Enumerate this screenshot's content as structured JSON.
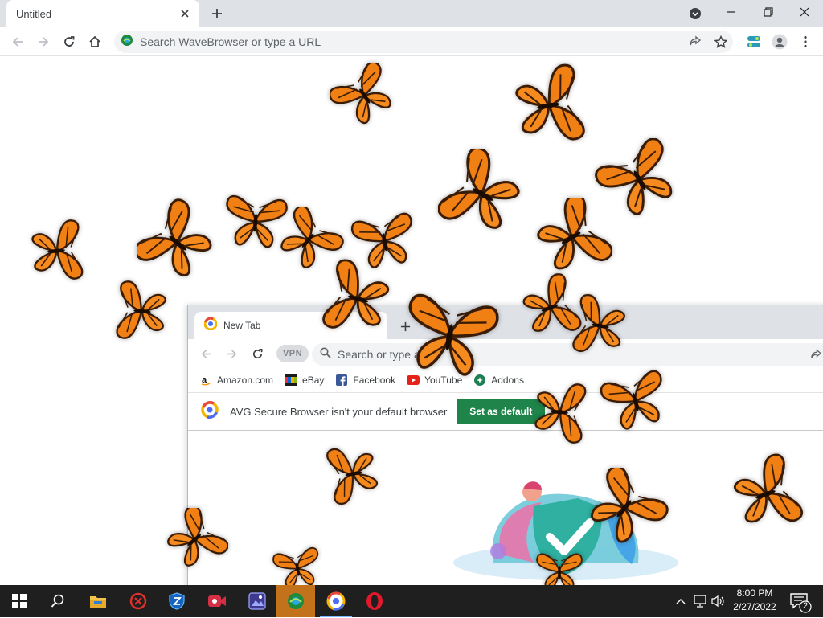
{
  "browser": {
    "tab_title": "Untitled",
    "omnibox_placeholder": "Search WaveBrowser or type a URL"
  },
  "inner_browser": {
    "tab_title": "New Tab",
    "vpn_label": "VPN",
    "omnibox_placeholder": "Search or type a U",
    "bookmarks": [
      {
        "label": "Amazon.com",
        "icon": "amazon-icon"
      },
      {
        "label": "eBay",
        "icon": "ebay-icon"
      },
      {
        "label": "Facebook",
        "icon": "facebook-icon"
      },
      {
        "label": "YouTube",
        "icon": "youtube-icon"
      },
      {
        "label": "Addons",
        "icon": "addons-icon"
      }
    ],
    "infobar_message": "AVG Secure Browser isn't your default browser",
    "set_default_label": "Set as default"
  },
  "taskbar": {
    "time": "8:00 PM",
    "date": "2/27/2022",
    "notification_count": "2",
    "apps": [
      "windows-start-icon",
      "search-icon",
      "file-explorer-icon",
      "antivirus-icon",
      "shield-icon",
      "video-recorder-icon",
      "image-app-icon",
      "wavebrowser-icon",
      "avg-browser-icon",
      "opera-icon"
    ]
  },
  "colors": {
    "butterfly_orange": "#f07f14",
    "butterfly_dark": "#3a1c06",
    "set_default_green": "#1e8449",
    "taskbar_bg": "#1f1f1f",
    "active_app": "#c2721b"
  }
}
